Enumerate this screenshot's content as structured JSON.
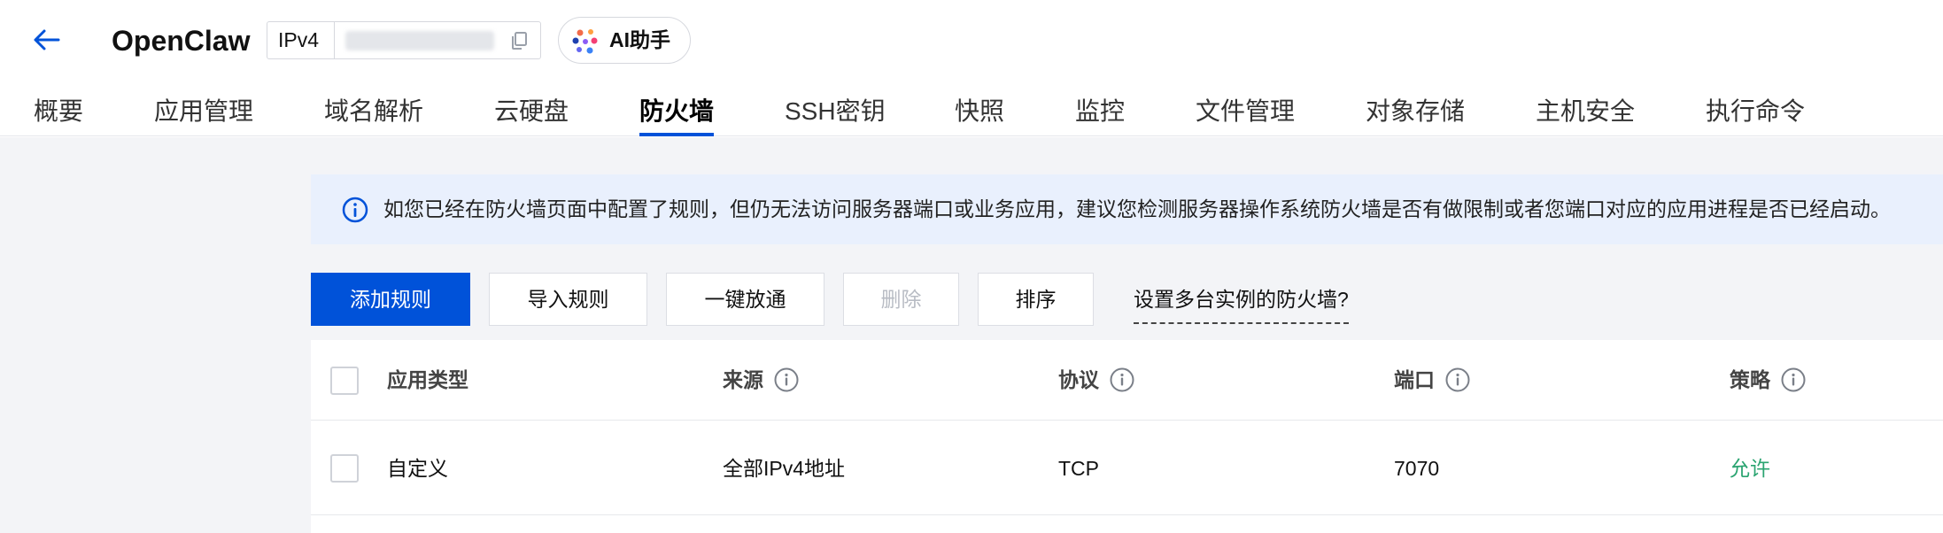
{
  "header": {
    "title": "OpenClaw",
    "ip": {
      "type_label": "IPv4"
    },
    "ai_button_label": "AI助手"
  },
  "tabs": [
    {
      "label": "概要",
      "active": false
    },
    {
      "label": "应用管理",
      "active": false
    },
    {
      "label": "域名解析",
      "active": false
    },
    {
      "label": "云硬盘",
      "active": false
    },
    {
      "label": "防火墙",
      "active": true
    },
    {
      "label": "SSH密钥",
      "active": false
    },
    {
      "label": "快照",
      "active": false
    },
    {
      "label": "监控",
      "active": false
    },
    {
      "label": "文件管理",
      "active": false
    },
    {
      "label": "对象存储",
      "active": false
    },
    {
      "label": "主机安全",
      "active": false
    },
    {
      "label": "执行命令",
      "active": false
    }
  ],
  "notice": {
    "text": "如您已经在防火墙页面中配置了规则，但仍无法访问服务器端口或业务应用，建议您检测服务器操作系统防火墙是否有做限制或者您端口对应的应用进程是否已经启动。"
  },
  "toolbar": {
    "add_rule": "添加规则",
    "import_rules": "导入规则",
    "one_click_open": "一键放通",
    "delete": "删除",
    "sort": "排序",
    "multi_instance_link": "设置多台实例的防火墙?"
  },
  "table": {
    "columns": {
      "app_type": "应用类型",
      "source": "来源",
      "protocol": "协议",
      "port": "端口",
      "policy": "策略"
    },
    "rows": [
      {
        "app_type": "自定义",
        "source": "全部IPv4地址",
        "protocol": "TCP",
        "port": "7070",
        "policy": "允许"
      }
    ]
  },
  "colors": {
    "primary": "#0052d9",
    "allow": "#2ba471",
    "notice_bg": "#e9f0fd",
    "page_bg": "#f3f4f7"
  }
}
